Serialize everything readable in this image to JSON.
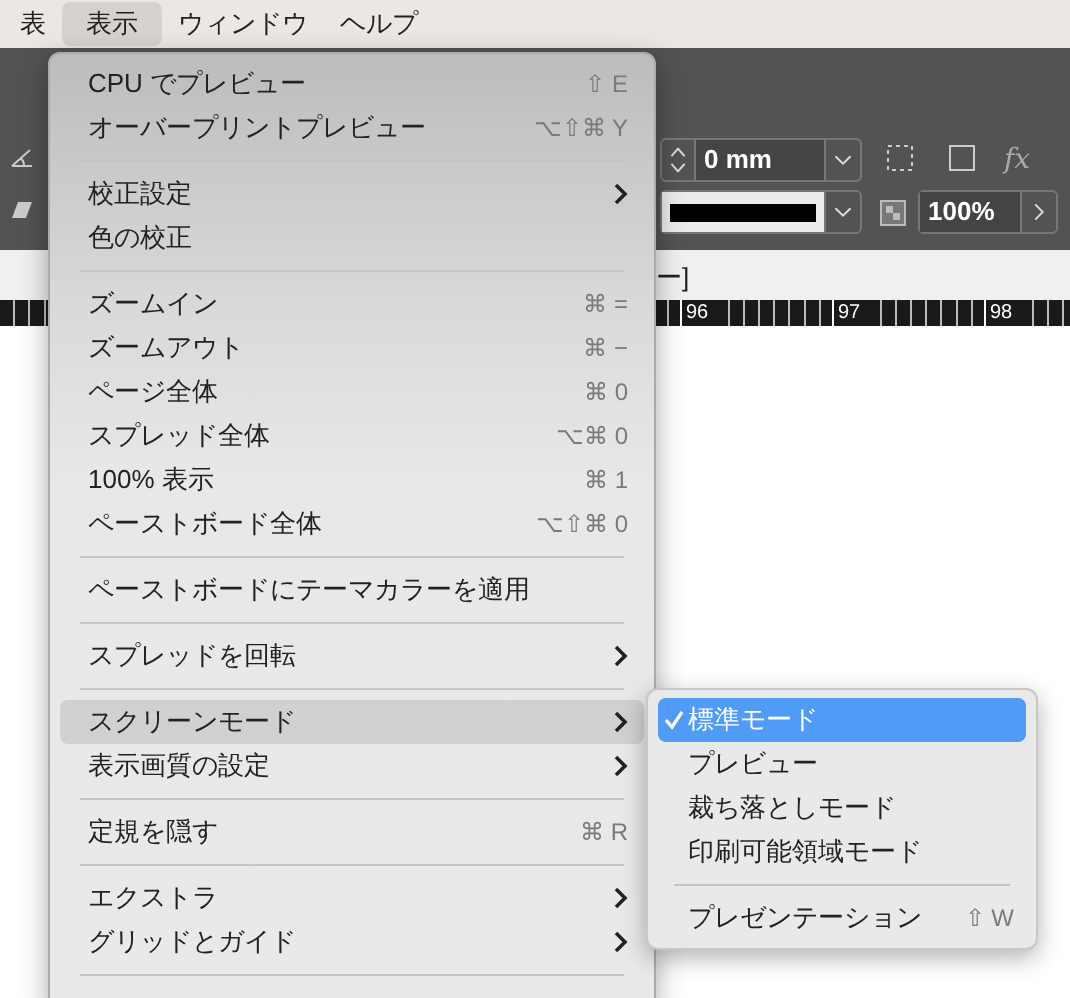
{
  "menu_bar": [
    {
      "label": "表",
      "selected": false
    },
    {
      "label": "表示",
      "selected": true
    },
    {
      "label": "ウィンドウ",
      "selected": false
    },
    {
      "label": "ヘルプ",
      "selected": false
    }
  ],
  "toolbar": {
    "stroke_weight": "0 mm",
    "opacity": "100%",
    "effects": "fx"
  },
  "document_tab": {
    "title": "ー]"
  },
  "ruler": {
    "labels": [
      "96",
      "97",
      "98"
    ]
  },
  "menu": [
    {
      "kind": "item",
      "label": "CPU でプレビュー",
      "shortcut": "⇧ E",
      "submenu": false,
      "selected": false
    },
    {
      "kind": "item",
      "label": "オーバープリントプレビュー",
      "shortcut": "⌥⇧⌘ Y",
      "submenu": false,
      "selected": false
    },
    {
      "kind": "separator"
    },
    {
      "kind": "item",
      "label": "校正設定",
      "submenu": true,
      "selected": false
    },
    {
      "kind": "item",
      "label": "色の校正",
      "submenu": false,
      "selected": false
    },
    {
      "kind": "separator"
    },
    {
      "kind": "item",
      "label": "ズームイン",
      "shortcut": "⌘ =",
      "submenu": false,
      "selected": false
    },
    {
      "kind": "item",
      "label": "ズームアウト",
      "shortcut": "⌘ −",
      "submenu": false,
      "selected": false
    },
    {
      "kind": "item",
      "label": "ページ全体",
      "shortcut": "⌘ 0",
      "submenu": false,
      "selected": false
    },
    {
      "kind": "item",
      "label": "スプレッド全体",
      "shortcut": "⌥⌘ 0",
      "submenu": false,
      "selected": false
    },
    {
      "kind": "item",
      "label": "100% 表示",
      "shortcut": "⌘ 1",
      "submenu": false,
      "selected": false
    },
    {
      "kind": "item",
      "label": "ペーストボード全体",
      "shortcut": "⌥⇧⌘ 0",
      "submenu": false,
      "selected": false
    },
    {
      "kind": "separator"
    },
    {
      "kind": "item",
      "label": "ペーストボードにテーマカラーを適用",
      "submenu": false,
      "selected": false
    },
    {
      "kind": "separator"
    },
    {
      "kind": "item",
      "label": "スプレッドを回転",
      "submenu": true,
      "selected": false
    },
    {
      "kind": "separator"
    },
    {
      "kind": "item",
      "label": "スクリーンモード",
      "submenu": true,
      "selected": true
    },
    {
      "kind": "item",
      "label": "表示画質の設定",
      "submenu": true,
      "selected": false
    },
    {
      "kind": "separator"
    },
    {
      "kind": "item",
      "label": "定規を隠す",
      "shortcut": "⌘ R",
      "submenu": false,
      "selected": false
    },
    {
      "kind": "separator"
    },
    {
      "kind": "item",
      "label": "エクストラ",
      "submenu": true,
      "selected": false
    },
    {
      "kind": "item",
      "label": "グリッドとガイド",
      "submenu": true,
      "selected": false
    },
    {
      "kind": "separator"
    }
  ],
  "submenu": [
    {
      "kind": "item",
      "label": "標準モード",
      "checked": true,
      "selected": true
    },
    {
      "kind": "item",
      "label": "プレビュー",
      "checked": false,
      "selected": false
    },
    {
      "kind": "item",
      "label": "裁ち落としモード",
      "checked": false,
      "selected": false
    },
    {
      "kind": "item",
      "label": "印刷可能領域モード",
      "checked": false,
      "selected": false
    },
    {
      "kind": "separator"
    },
    {
      "kind": "item",
      "label": "プレゼンテーション",
      "shortcut": "⇧ W",
      "checked": false,
      "selected": false
    }
  ]
}
